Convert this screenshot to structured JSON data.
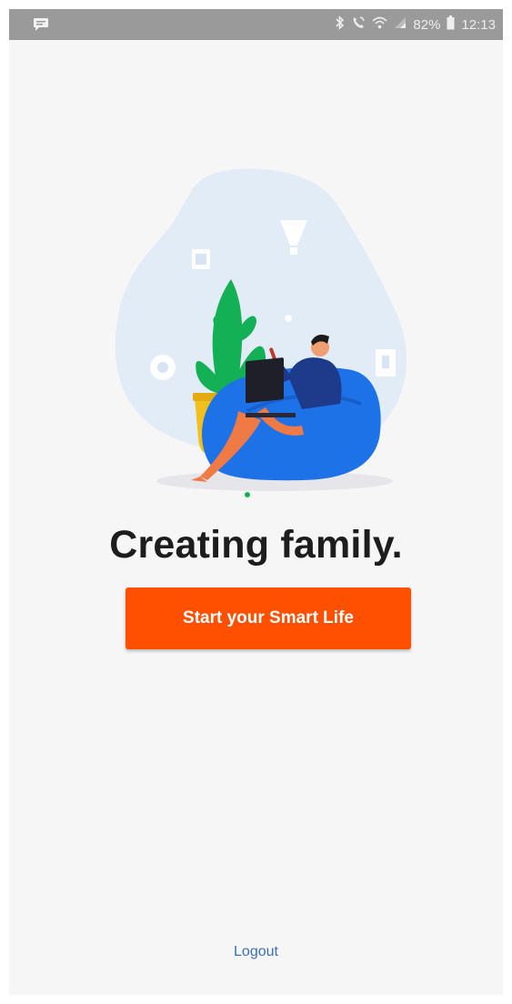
{
  "status_bar": {
    "notification_icon": "chat-bubble-icon",
    "bluetooth_icon": "bluetooth-icon",
    "call_icon": "wifi-calling-icon",
    "wifi_icon": "wifi-icon",
    "signal_icon": "cellular-signal-icon",
    "battery_percent": "82%",
    "battery_icon": "battery-icon",
    "time": "12:13"
  },
  "illustration": {
    "subject": "person-with-laptop-on-beanbag-illustration",
    "colors": {
      "blob": "#e1ecf7",
      "beanbag": "#1d72e8",
      "plant": "#14b055",
      "pot": "#f2c01c",
      "legs": "#f07a45",
      "shirt": "#1e3a8a"
    }
  },
  "main": {
    "title": "Creating family.",
    "start_button_label": "Start your Smart Life",
    "logout_label": "Logout"
  },
  "colors": {
    "accent": "#ff4f00",
    "link": "#3a6fb7",
    "background": "#f6f6f6"
  }
}
